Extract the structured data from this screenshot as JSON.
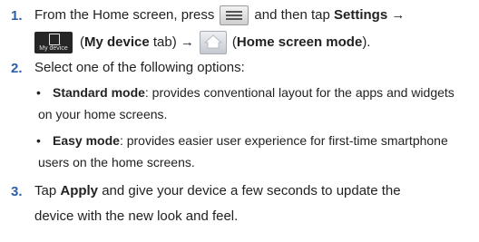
{
  "steps": [
    {
      "number": "1.",
      "line1": {
        "pre": "From the Home screen, press",
        "mid": "and then tap",
        "settings": "Settings",
        "arrow": "→"
      },
      "line2": {
        "icon_caption": "My device",
        "open_paren": "(",
        "my_device": "My device",
        "tab_text": "tab)",
        "arrow": "→",
        "home_mode": "Home screen mode",
        "close": ")."
      }
    },
    {
      "number": "2.",
      "text": "Select one of the following options:",
      "bullets": [
        {
          "term": "Standard mode",
          "desc1": ": provides conventional layout for the apps and widgets",
          "desc2": "on your home screens."
        },
        {
          "term": "Easy mode",
          "desc1": ": provides easier user experience for first-time smartphone",
          "desc2": "users on the home screens."
        }
      ]
    },
    {
      "number": "3.",
      "line1_pre": "Tap",
      "apply": "Apply",
      "line1_post": "and give your device a few seconds to update the",
      "line2": "device with the new look and feel."
    }
  ],
  "icons": [
    "menu-icon",
    "my-device-icon",
    "home-icon"
  ]
}
